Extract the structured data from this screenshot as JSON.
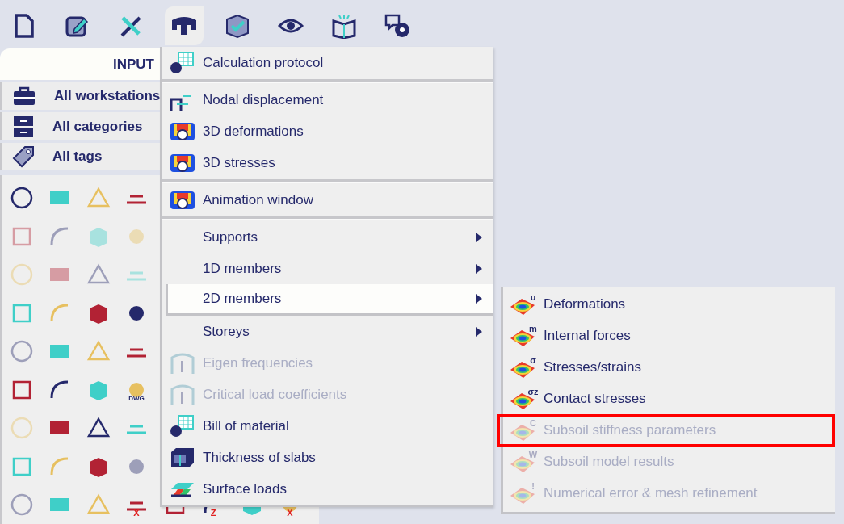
{
  "toolbar": [
    {
      "selected": false
    },
    {
      "selected": false
    },
    {
      "selected": false
    },
    {
      "selected": true
    },
    {
      "selected": false
    },
    {
      "selected": false
    },
    {
      "selected": false
    },
    {
      "selected": false
    }
  ],
  "sidebar": {
    "header": "INPUT",
    "filters": [
      "All workstations",
      "All categories",
      "All tags"
    ],
    "tools": [
      {
        "disabled": false
      },
      {
        "disabled": false
      },
      {
        "disabled": false
      },
      {
        "disabled": false
      },
      {
        "disabled": true
      },
      {
        "disabled": true
      },
      {
        "disabled": true
      },
      {
        "disabled": true
      },
      {
        "disabled": true
      },
      {
        "disabled": true
      },
      {
        "disabled": true
      },
      {
        "disabled": true
      },
      {
        "disabled": false
      },
      {
        "disabled": false
      },
      {
        "disabled": false
      },
      {
        "disabled": false
      },
      {
        "disabled": true
      },
      {
        "disabled": false
      },
      {
        "disabled": false
      },
      {
        "disabled": false
      },
      {
        "disabled": false
      },
      {
        "disabled": false
      },
      {
        "disabled": false
      },
      {
        "disabled": false,
        "label": "DWG"
      },
      {
        "disabled": true
      },
      {
        "disabled": false
      },
      {
        "disabled": false
      },
      {
        "disabled": false
      },
      {
        "disabled": false
      },
      {
        "disabled": false
      },
      {
        "disabled": false
      },
      {
        "disabled": true
      },
      {
        "disabled": true
      },
      {
        "disabled": false
      },
      {
        "disabled": false
      },
      {
        "disabled": false,
        "label": "X"
      },
      {
        "disabled": false
      },
      {
        "disabled": false,
        "label": "Z"
      },
      {
        "disabled": false
      },
      {
        "disabled": false,
        "label": "X"
      }
    ]
  },
  "menu": [
    {
      "kind": "item",
      "label": "Calculation protocol",
      "disabled": false,
      "submenu": false,
      "selected": false
    },
    {
      "kind": "separator"
    },
    {
      "kind": "item",
      "label": "Nodal displacement",
      "disabled": false,
      "submenu": false,
      "selected": false
    },
    {
      "kind": "item",
      "label": "3D deformations",
      "disabled": false,
      "submenu": false,
      "selected": false
    },
    {
      "kind": "item",
      "label": "3D stresses",
      "disabled": false,
      "submenu": false,
      "selected": false
    },
    {
      "kind": "separator"
    },
    {
      "kind": "item",
      "label": "Animation window",
      "disabled": false,
      "submenu": false,
      "selected": false
    },
    {
      "kind": "separator"
    },
    {
      "kind": "item",
      "label": "Supports",
      "disabled": false,
      "submenu": true,
      "selected": false
    },
    {
      "kind": "item",
      "label": "1D members",
      "disabled": false,
      "submenu": true,
      "selected": false
    },
    {
      "kind": "item",
      "label": "2D members",
      "disabled": false,
      "submenu": true,
      "selected": true
    },
    {
      "kind": "item",
      "label": "Storeys",
      "disabled": false,
      "submenu": true,
      "selected": false
    },
    {
      "kind": "item",
      "label": "Eigen frequencies",
      "disabled": true,
      "submenu": false,
      "selected": false
    },
    {
      "kind": "item",
      "label": "Critical load coefficients",
      "disabled": true,
      "submenu": false,
      "selected": false
    },
    {
      "kind": "item",
      "label": "Bill of material",
      "disabled": false,
      "submenu": false,
      "selected": false
    },
    {
      "kind": "item",
      "label": "Thickness of slabs",
      "disabled": false,
      "submenu": false,
      "selected": false
    },
    {
      "kind": "item",
      "label": "Surface loads",
      "disabled": false,
      "submenu": false,
      "selected": false
    }
  ],
  "submenu": [
    {
      "label": "Deformations",
      "disabled": false,
      "marked": false,
      "icon_letter": "u"
    },
    {
      "label": "Internal forces",
      "disabled": false,
      "marked": false,
      "icon_letter": "m"
    },
    {
      "label": "Stresses/strains",
      "disabled": false,
      "marked": false,
      "icon_letter": "σ"
    },
    {
      "label": "Contact stresses",
      "disabled": false,
      "marked": false,
      "icon_letter": "σz"
    },
    {
      "label": "Subsoil stiffness parameters",
      "disabled": true,
      "marked": true,
      "icon_letter": "C"
    },
    {
      "label": "Subsoil model results",
      "disabled": true,
      "marked": false,
      "icon_letter": "W"
    },
    {
      "label": "Numerical error & mesh refinement",
      "disabled": true,
      "marked": false,
      "icon_letter": "!"
    }
  ]
}
